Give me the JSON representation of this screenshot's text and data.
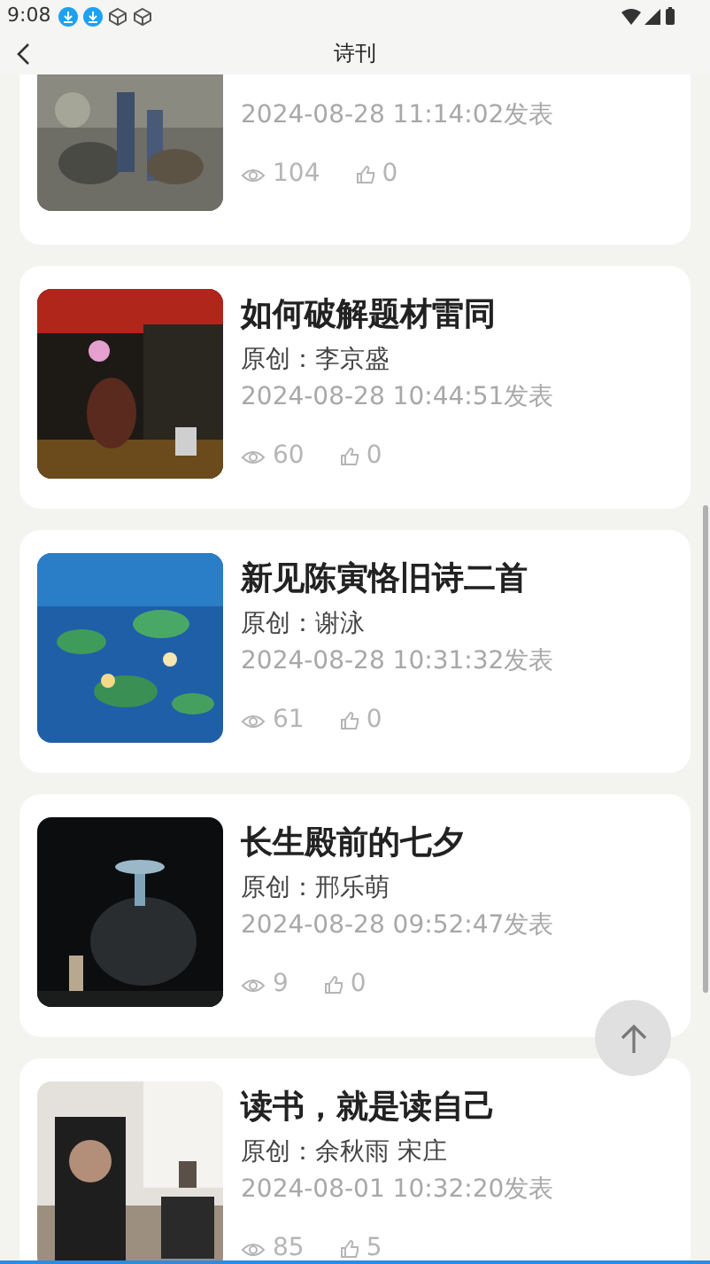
{
  "status_bar": {
    "time": "9:08"
  },
  "header": {
    "title": "诗刊"
  },
  "articles": [
    {
      "kind": "clipped",
      "date": "2024-08-28 11:14:02发表",
      "views": "104",
      "likes": "0"
    },
    {
      "kind": "full",
      "title": "如何破解题材雷同",
      "author": "原创：李京盛",
      "date": "2024-08-28 10:44:51发表",
      "views": "60",
      "likes": "0"
    },
    {
      "kind": "full",
      "title": "新见陈寅恪旧诗二首",
      "author": "原创：谢泳",
      "date": "2024-08-28 10:31:32发表",
      "views": "61",
      "likes": "0"
    },
    {
      "kind": "full",
      "title": "长生殿前的七夕",
      "author": "原创：邢乐萌",
      "date": "2024-08-28 09:52:47发表",
      "views": "9",
      "likes": "0"
    },
    {
      "kind": "full",
      "title": "读书，就是读自己",
      "author": "原创：余秋雨 宋庄",
      "date": "2024-08-01 10:32:20发表",
      "views": "85",
      "likes": "5"
    }
  ]
}
